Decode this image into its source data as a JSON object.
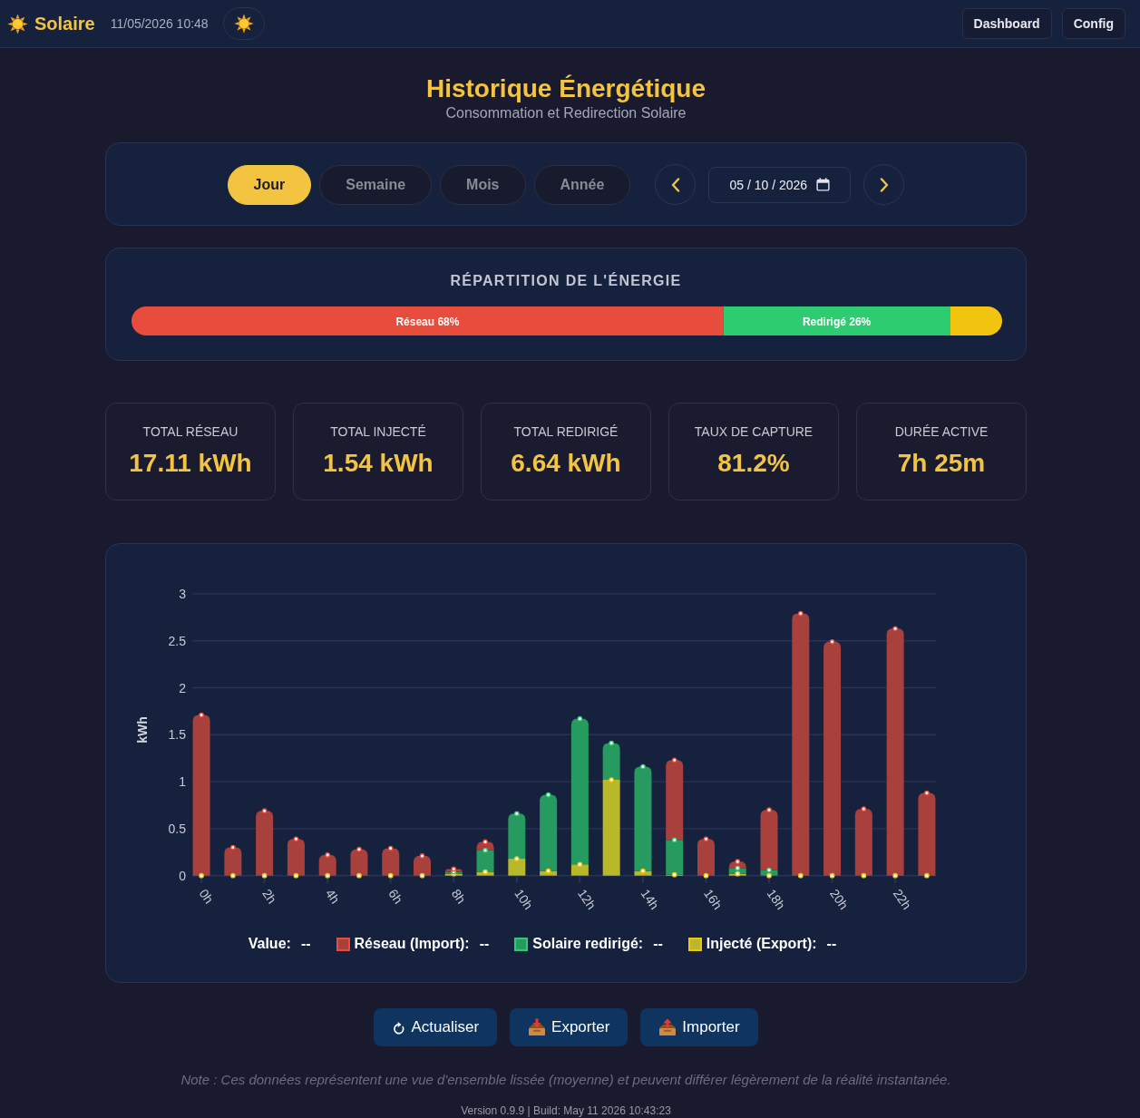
{
  "navbar": {
    "brand": "Solaire",
    "datetime": "11/05/2026 10:48",
    "buttons": [
      {
        "label": "Dashboard"
      },
      {
        "label": "Config"
      }
    ]
  },
  "header": {
    "title": "Historique Énergétique",
    "subtitle": "Consommation et Redirection Solaire"
  },
  "period_tabs": [
    {
      "label": "Jour",
      "selected": true
    },
    {
      "label": "Semaine",
      "selected": false
    },
    {
      "label": "Mois",
      "selected": false
    },
    {
      "label": "Année",
      "selected": false
    }
  ],
  "date_field": {
    "value": "05 / 10 / 2026"
  },
  "energy_split": {
    "title": "RÉPARTITION DE L'ÉNERGIE",
    "chart_data": {
      "type": "bar",
      "orientation": "horizontal",
      "stacked": true,
      "series": [
        {
          "color": "#e74c3c",
          "values": [
            68
          ],
          "value_labels": [
            "Réseau 68%"
          ]
        },
        {
          "color": "#2ecc71",
          "values": [
            26
          ],
          "value_labels": [
            "Redirigé 26%"
          ]
        },
        {
          "color": "#f1c40f",
          "values": [
            6
          ]
        }
      ]
    }
  },
  "stats": [
    {
      "label": "TOTAL RÉSEAU",
      "value": "17.11 kWh"
    },
    {
      "label": "TOTAL INJECTÉ",
      "value": "1.54 kWh"
    },
    {
      "label": "TOTAL REDIRIGÉ",
      "value": "6.64 kWh"
    },
    {
      "label": "TAUX DE CAPTURE",
      "value": "81.2%"
    },
    {
      "label": "DURÉE ACTIVE",
      "value": "7h 25m"
    }
  ],
  "chart": {
    "chart_data": {
      "type": "bar",
      "ylabel": "kWh",
      "stacked": true,
      "grid": true,
      "legend": "bottom",
      "x": [
        0,
        1,
        2,
        3,
        4,
        5,
        6,
        7,
        8,
        9,
        10,
        11,
        12,
        13,
        14,
        15,
        16,
        17,
        18,
        19,
        20,
        21,
        22,
        23
      ],
      "xlim": [
        -0.29,
        23.29
      ],
      "ylim": [
        0,
        3
      ],
      "yticks": [
        0,
        0.5,
        1,
        1.5,
        2,
        2.5,
        3
      ],
      "xticks": [
        {
          "value": 0,
          "label": "0h"
        },
        {
          "value": 2,
          "label": "2h"
        },
        {
          "value": 4,
          "label": "4h"
        },
        {
          "value": 6,
          "label": "6h"
        },
        {
          "value": 8,
          "label": "8h"
        },
        {
          "value": 10,
          "label": "10h"
        },
        {
          "value": 12,
          "label": "12h"
        },
        {
          "value": 14,
          "label": "14h"
        },
        {
          "value": 16,
          "label": "16h"
        },
        {
          "value": 18,
          "label": "18h"
        },
        {
          "value": 20,
          "label": "20h"
        },
        {
          "value": 22,
          "label": "22h"
        }
      ],
      "series": [
        {
          "name": "Injecté (Export):",
          "color": "#b8b82a",
          "values": [
            0,
            0,
            0,
            0,
            0,
            0,
            0,
            0,
            0.02,
            0.04,
            0.18,
            0.05,
            0.12,
            1.02,
            0.05,
            0.01,
            0,
            0.02,
            0,
            0,
            0,
            0,
            0,
            0
          ]
        },
        {
          "name": "Solaire redirigé:",
          "color": "#279a60",
          "values": [
            0,
            0,
            0,
            0,
            0,
            0,
            0,
            0,
            0.02,
            0.23,
            0.48,
            0.81,
            1.55,
            0.39,
            1.11,
            0.37,
            0,
            0.06,
            0.06,
            0,
            0,
            0,
            0,
            0
          ]
        },
        {
          "name": "Réseau (Import):",
          "color": "#a8403c",
          "values": [
            1.71,
            0.3,
            0.69,
            0.39,
            0.22,
            0.28,
            0.29,
            0.21,
            0.03,
            0.09,
            0,
            0,
            0,
            0,
            0,
            0.85,
            0.39,
            0.07,
            0.64,
            2.79,
            2.49,
            0.71,
            2.63,
            0.88
          ]
        }
      ]
    },
    "legend_readout": {
      "value_label": "Value:",
      "value": "--",
      "items": [
        {
          "color": "#e74c3c",
          "value": "--"
        },
        {
          "color": "#2ecc71",
          "value": "--"
        },
        {
          "color": "#f1c40f",
          "value": "--"
        }
      ]
    }
  },
  "actions": [
    {
      "kind": "refresh",
      "label": "Actualiser"
    },
    {
      "kind": "tray_in",
      "label": "Exporter"
    },
    {
      "kind": "tray_out",
      "label": "Importer"
    }
  ],
  "note": "Note : Ces données représentent une vue d'ensemble lissée (moyenne) et peuvent différer légèrement de la réalité instantanée.",
  "footer": "Version 0.9.9 | Build: May 11 2026 10:43:23"
}
